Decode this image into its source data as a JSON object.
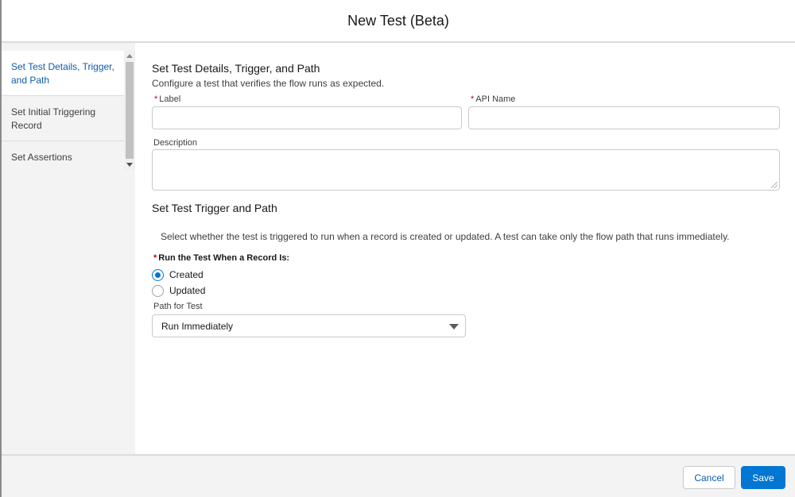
{
  "modal": {
    "title": "New Test (Beta)"
  },
  "sidebar": {
    "items": [
      {
        "line1": "Set Test Details, Trigger,",
        "line2": "and Path",
        "active": true
      },
      {
        "line1": "Set Initial Triggering",
        "line2": "Record",
        "active": false
      },
      {
        "line1": "Set Assertions",
        "line2": "",
        "active": false
      }
    ]
  },
  "details": {
    "title": "Set Test Details, Trigger, and Path",
    "description": "Configure a test that verifies the flow runs as expected.",
    "required_mark": "*",
    "label_field": {
      "label": "Label",
      "value": ""
    },
    "api_name_field": {
      "label": "API Name",
      "value": ""
    },
    "description_field": {
      "label": "Description",
      "value": ""
    }
  },
  "trigger": {
    "title": "Set Test Trigger and Path",
    "help": "Select whether the test is triggered to run when a record is created or updated. A test can take only the flow path that runs immediately.",
    "radio_group_label": "Run the Test When a Record Is:",
    "options": [
      {
        "label": "Created",
        "checked": true
      },
      {
        "label": "Updated",
        "checked": false
      }
    ],
    "path_label": "Path for Test",
    "path_value": "Run Immediately"
  },
  "footer": {
    "cancel_label": "Cancel",
    "save_label": "Save"
  },
  "colors": {
    "brand": "#0176d3",
    "link": "#0b5cab",
    "required": "#ba0517"
  }
}
